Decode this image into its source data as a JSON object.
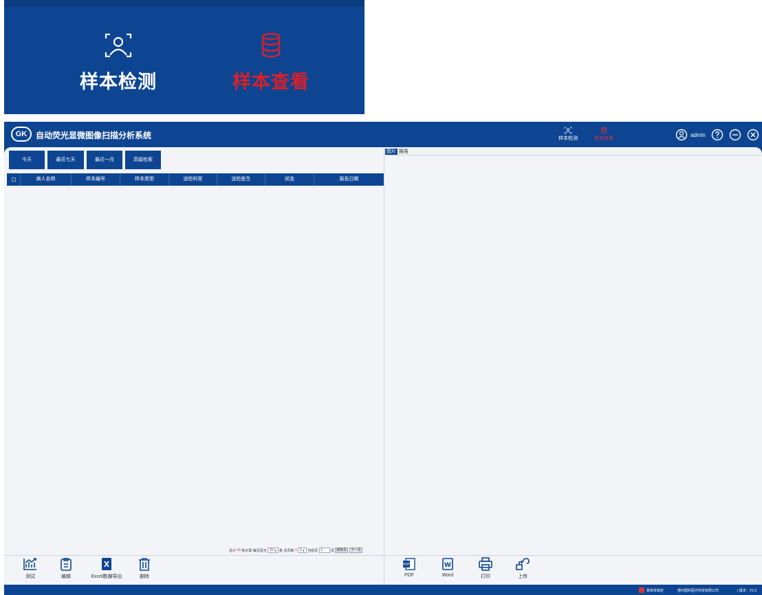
{
  "zoom": {
    "detect_label": "样本检测",
    "view_label": "样本查看"
  },
  "app": {
    "logo_text": "GK",
    "title": "自动荧光显微图像扫描分析系统"
  },
  "nav": {
    "detect_label": "样本检测",
    "view_label": "样本查看"
  },
  "user": {
    "name": "admin"
  },
  "filters": {
    "today": "今天",
    "last7": "最近七天",
    "last_month": "最近一月",
    "advanced": "高级检索"
  },
  "table": {
    "columns": [
      "病人名称",
      "样本编号",
      "样本类型",
      "送检科室",
      "送检医生",
      "状态",
      "报告日期"
    ],
    "rows": []
  },
  "pager": {
    "total_label": "总计",
    "total": "16",
    "records_label": "条记录",
    "per_page_label": "每页显示",
    "per_page": "20",
    "unit": "条",
    "pages_label": "总页数",
    "pages": "1",
    "page_select": "1",
    "current_label": "当前页",
    "current": "1",
    "page_unit": "页",
    "jump": "跳到页",
    "next": "下一页"
  },
  "left_tools": {
    "test": "测试",
    "edit": "编辑",
    "excel": "Excel数据导出",
    "delete": "删除"
  },
  "tabs": {
    "image": "图片",
    "report": "报告"
  },
  "right_tools": {
    "pdf": "PDF",
    "word": "Word",
    "print": "打印",
    "upload": "上传"
  },
  "status": {
    "lock": "系统未锁定",
    "company": "德州国科医疗科技有限公司",
    "version": "| 版本：V1.0"
  },
  "colors": {
    "primary": "#0d4592",
    "accent": "#d8202a",
    "panel": "#f2f4f7"
  }
}
